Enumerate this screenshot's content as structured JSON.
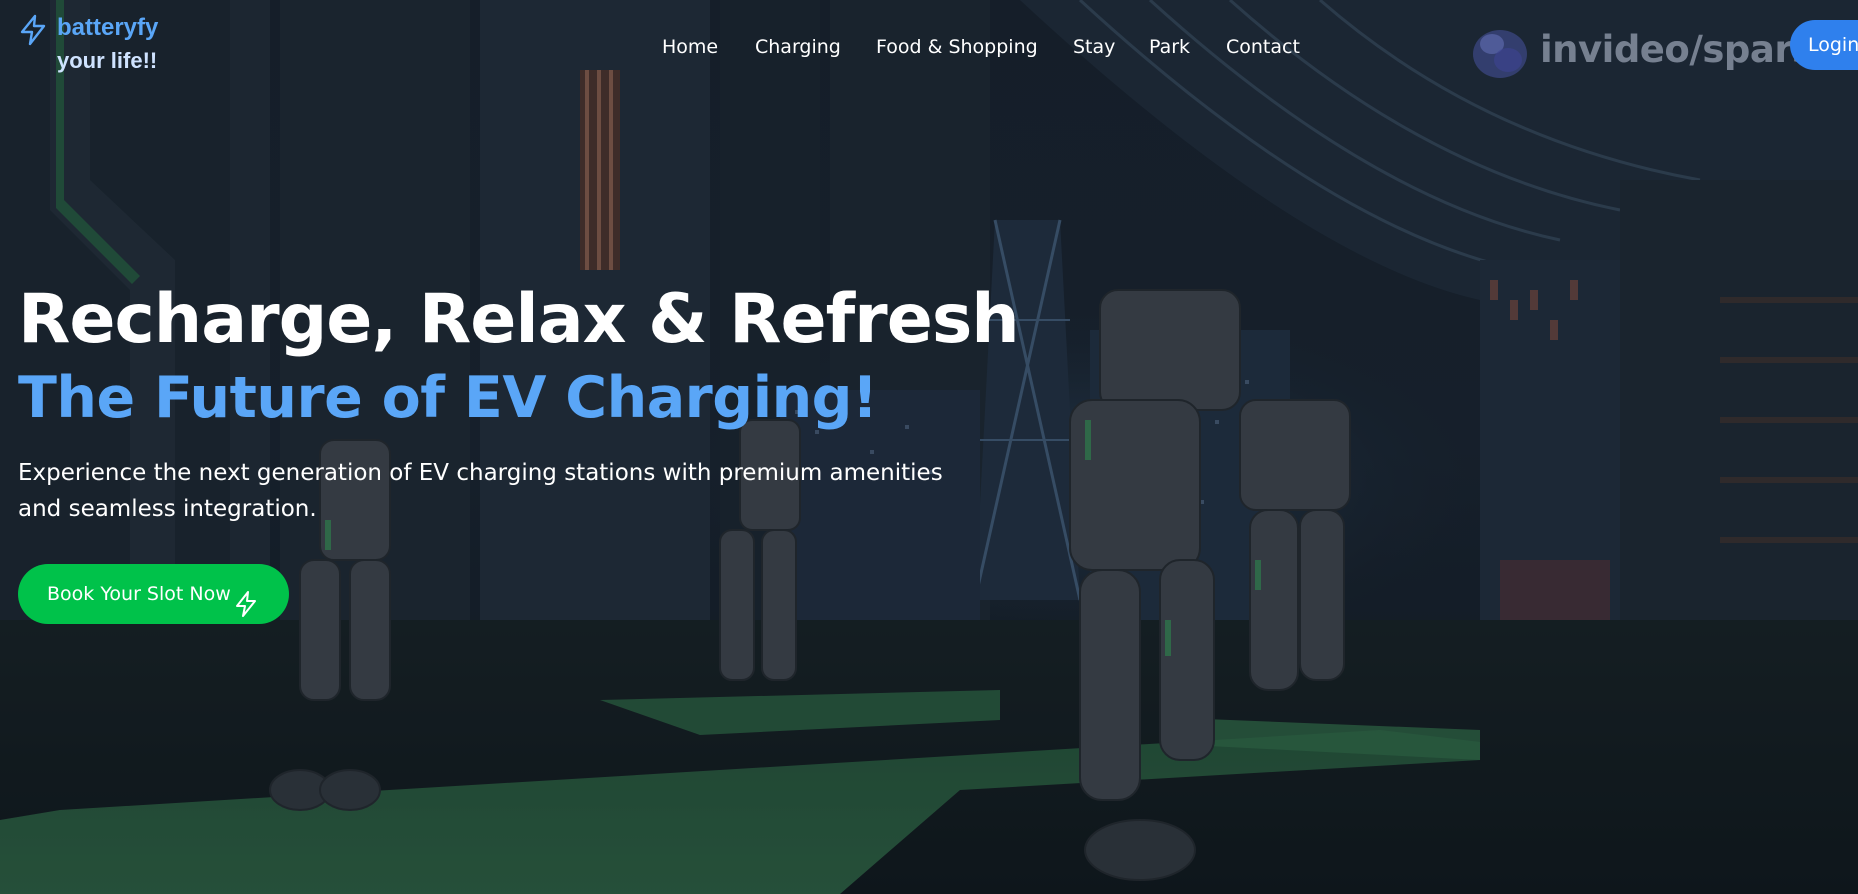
{
  "brand": {
    "name": "batteryfy",
    "tagline": "your life!!",
    "icon": "lightning-bolt-icon",
    "color": "#5aa6f7"
  },
  "nav": {
    "items": [
      {
        "label": "Home"
      },
      {
        "label": "Charging"
      },
      {
        "label": "Food & Shopping"
      },
      {
        "label": "Stay"
      },
      {
        "label": "Park"
      },
      {
        "label": "Contact"
      }
    ]
  },
  "watermark": {
    "text": "invideo/spars",
    "icon": "invideo-logo-icon"
  },
  "login": {
    "label": "Login",
    "color": "#2f80ed"
  },
  "hero": {
    "title": "Recharge, Relax & Refresh",
    "subtitle": "The Future of EV Charging!",
    "subtitle_color": "#5aa6f7",
    "description": "Experience the next generation of EV charging stations with premium amenities and seamless integration.",
    "cta": {
      "label": "Book Your Slot Now",
      "icon": "lightning-bolt-icon",
      "color": "#00c24a"
    }
  },
  "background": {
    "scene": "robot-charging-station-city-night",
    "accent": "#2e8a4f"
  }
}
